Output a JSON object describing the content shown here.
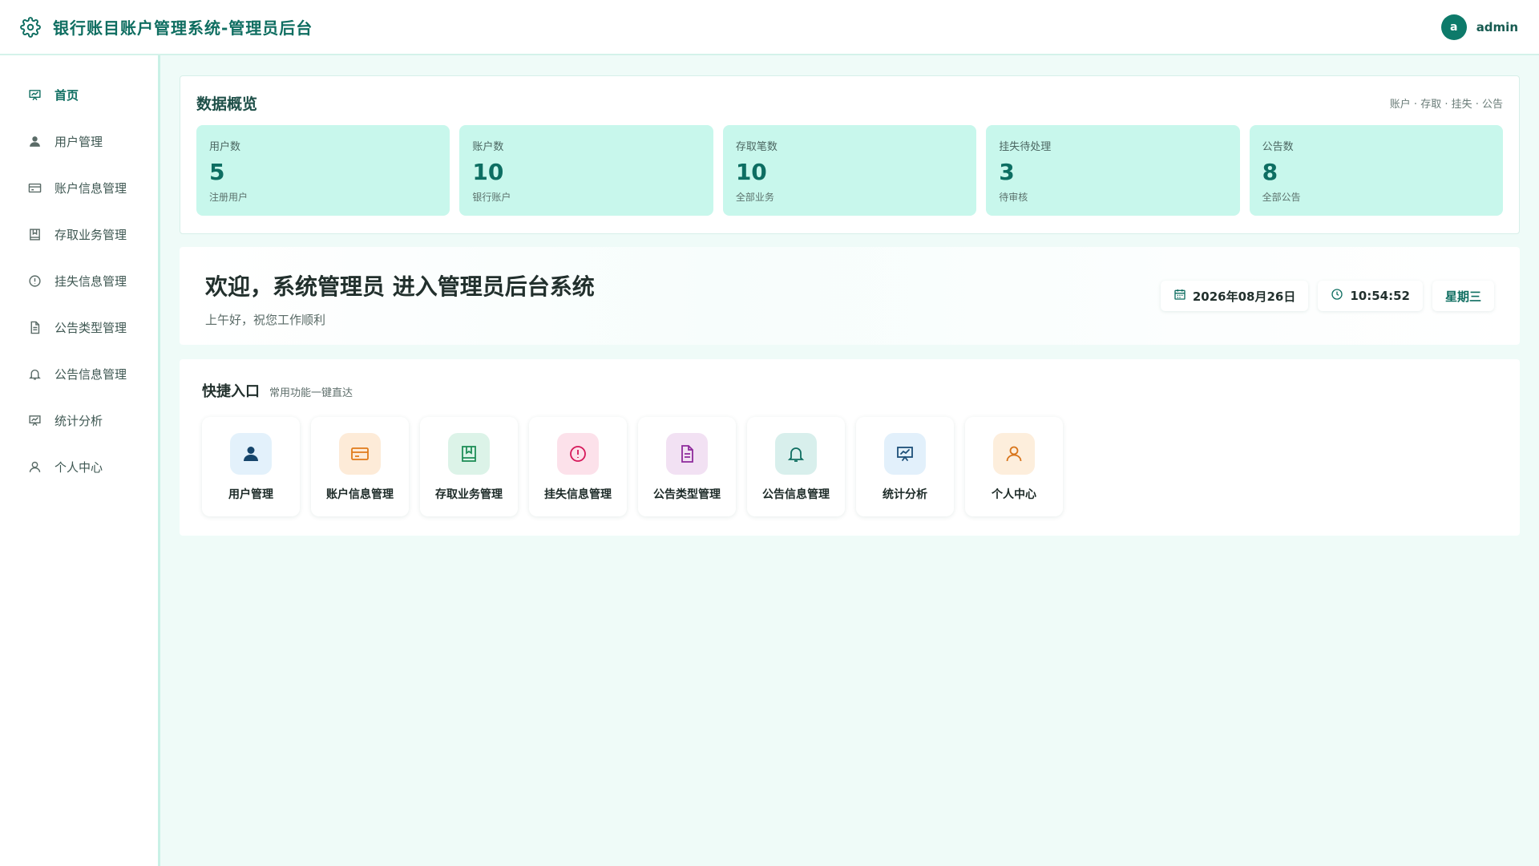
{
  "header": {
    "title": "银行账目账户管理系统-管理员后台",
    "avatar_letter": "a",
    "username": "admin"
  },
  "sidebar": {
    "items": [
      {
        "label": "首页",
        "icon": "presentation-icon",
        "active": true
      },
      {
        "label": "用户管理",
        "icon": "user-filled-icon"
      },
      {
        "label": "账户信息管理",
        "icon": "credit-card-icon"
      },
      {
        "label": "存取业务管理",
        "icon": "ledger-icon"
      },
      {
        "label": "挂失信息管理",
        "icon": "alert-circle-icon"
      },
      {
        "label": "公告类型管理",
        "icon": "document-icon"
      },
      {
        "label": "公告信息管理",
        "icon": "bell-icon"
      },
      {
        "label": "统计分析",
        "icon": "presentation-icon"
      },
      {
        "label": "个人中心",
        "icon": "user-outline-icon"
      }
    ]
  },
  "overview": {
    "title": "数据概览",
    "subtitle": "账户 · 存取 · 挂失 · 公告",
    "stats": [
      {
        "label": "用户数",
        "value": "5",
        "desc": "注册用户"
      },
      {
        "label": "账户数",
        "value": "10",
        "desc": "银行账户"
      },
      {
        "label": "存取笔数",
        "value": "10",
        "desc": "全部业务"
      },
      {
        "label": "挂失待处理",
        "value": "3",
        "desc": "待审核"
      },
      {
        "label": "公告数",
        "value": "8",
        "desc": "全部公告"
      }
    ]
  },
  "welcome": {
    "title": "欢迎，系统管理员 进入管理员后台系统",
    "subtitle": "上午好，祝您工作顺利",
    "date": "2026年08月26日",
    "time": "10:54:52",
    "weekday": "星期三"
  },
  "quick": {
    "title": "快捷入口",
    "subtitle": "常用功能一键直达",
    "tiles": [
      {
        "label": "用户管理",
        "icon": "user-filled-icon",
        "bg": "#e3f1fb",
        "color": "#16456b"
      },
      {
        "label": "账户信息管理",
        "icon": "credit-card-icon",
        "bg": "#fdebd8",
        "color": "#e07b1a"
      },
      {
        "label": "存取业务管理",
        "icon": "ledger-icon",
        "bg": "#dcf3e8",
        "color": "#1f8e57"
      },
      {
        "label": "挂失信息管理",
        "icon": "alert-circle-icon",
        "bg": "#fce1ea",
        "color": "#d6185a"
      },
      {
        "label": "公告类型管理",
        "icon": "document-icon",
        "bg": "#f2e1f3",
        "color": "#8e2a9c"
      },
      {
        "label": "公告信息管理",
        "icon": "bell-icon",
        "bg": "#d8efec",
        "color": "#0f6e61"
      },
      {
        "label": "统计分析",
        "icon": "presentation-icon",
        "bg": "#e2f0fb",
        "color": "#1c4f78"
      },
      {
        "label": "个人中心",
        "icon": "user-outline-icon",
        "bg": "#fdeedc",
        "color": "#d8741a"
      }
    ]
  },
  "colors": {
    "accent": "#0f6e61",
    "stat_bg": "#c8f7ec",
    "page_bg": "#effbf8"
  }
}
